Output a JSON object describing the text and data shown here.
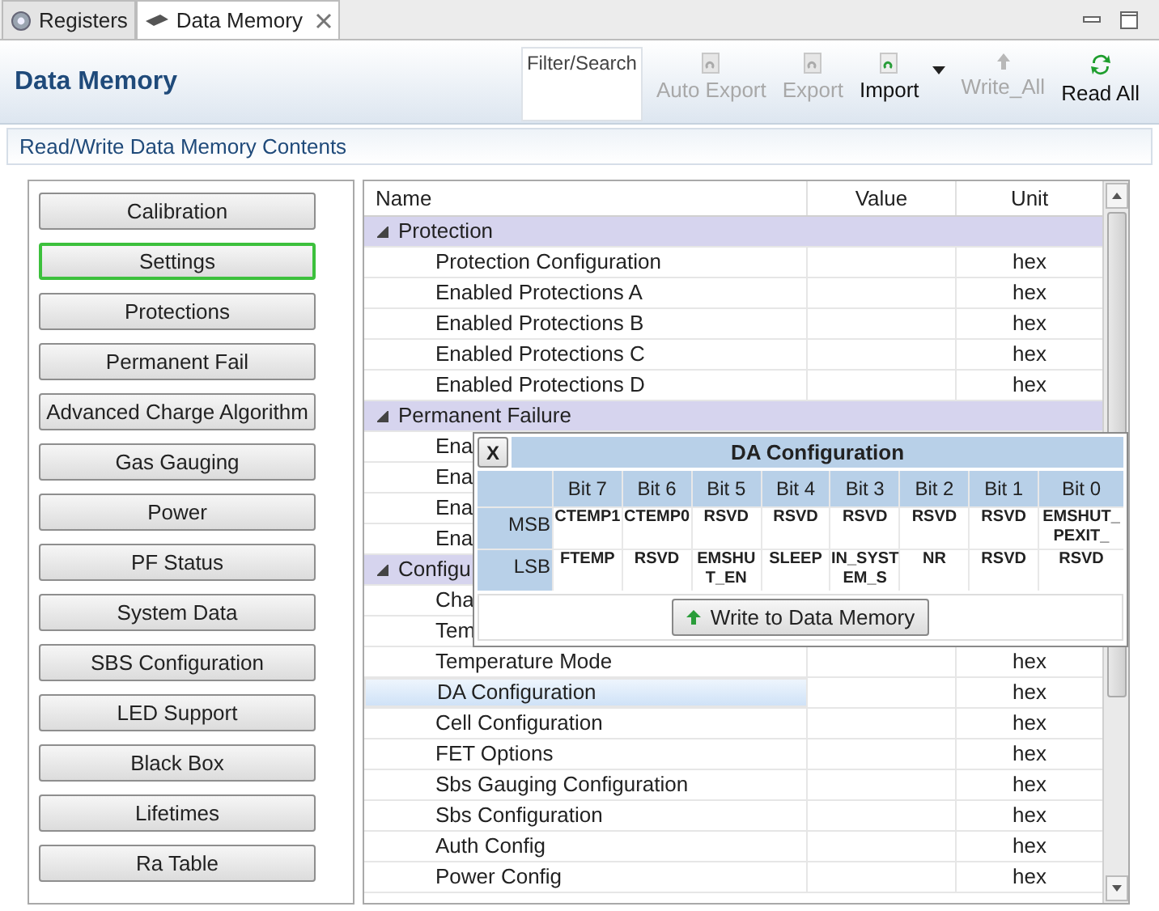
{
  "tabs": [
    {
      "label": "Registers",
      "selected": false,
      "closable": false
    },
    {
      "label": "Data Memory",
      "selected": true,
      "closable": true
    }
  ],
  "header": {
    "title": "Data Memory",
    "filter_placeholder": "Filter/Search"
  },
  "toolbar": [
    {
      "label": "Auto Export",
      "disabled": true,
      "kind": "export"
    },
    {
      "label": "Export",
      "disabled": true,
      "kind": "export"
    },
    {
      "label": "Import",
      "disabled": false,
      "kind": "import",
      "menu": true
    },
    {
      "label": "Write_All",
      "disabled": true,
      "kind": "write"
    },
    {
      "label": "Read All",
      "disabled": false,
      "kind": "read"
    }
  ],
  "section_title": "Read/Write Data Memory Contents",
  "categories": [
    {
      "label": "Calibration",
      "selected": false
    },
    {
      "label": "Settings",
      "selected": true
    },
    {
      "label": "Protections",
      "selected": false
    },
    {
      "label": "Permanent Fail",
      "selected": false
    },
    {
      "label": "Advanced Charge Algorithm",
      "selected": false
    },
    {
      "label": "Gas Gauging",
      "selected": false
    },
    {
      "label": "Power",
      "selected": false
    },
    {
      "label": "PF Status",
      "selected": false
    },
    {
      "label": "System Data",
      "selected": false
    },
    {
      "label": "SBS Configuration",
      "selected": false
    },
    {
      "label": "LED Support",
      "selected": false
    },
    {
      "label": "Black Box",
      "selected": false
    },
    {
      "label": "Lifetimes",
      "selected": false
    },
    {
      "label": "Ra Table",
      "selected": false
    }
  ],
  "table": {
    "columns": [
      "Name",
      "Value",
      "Unit"
    ],
    "groups": [
      {
        "name": "Protection",
        "expanded": true,
        "children": [
          {
            "name": "Protection Configuration",
            "unit": "hex",
            "selected": false
          },
          {
            "name": "Enabled Protections A",
            "unit": "hex",
            "selected": false
          },
          {
            "name": "Enabled Protections B",
            "unit": "hex",
            "selected": false
          },
          {
            "name": "Enabled Protections C",
            "unit": "hex",
            "selected": false
          },
          {
            "name": "Enabled Protections D",
            "unit": "hex",
            "selected": false
          }
        ]
      },
      {
        "name": "Permanent Failure",
        "expanded": true,
        "children": [
          {
            "name": "Ena",
            "selected": false
          },
          {
            "name": "Ena",
            "selected": false
          },
          {
            "name": "Ena",
            "selected": false
          },
          {
            "name": "Ena",
            "selected": false
          }
        ]
      },
      {
        "name": "Configu",
        "expanded": true,
        "children": [
          {
            "name": "Cha",
            "selected": false
          },
          {
            "name": "Tem",
            "selected": false
          },
          {
            "name": "Temperature Mode",
            "unit": "hex",
            "selected": false
          },
          {
            "name": "DA Configuration",
            "unit": "hex",
            "selected": true
          },
          {
            "name": "Cell Configuration",
            "unit": "hex",
            "selected": false
          },
          {
            "name": "FET Options",
            "unit": "hex",
            "selected": false
          },
          {
            "name": "Sbs Gauging Configuration",
            "unit": "hex",
            "selected": false
          },
          {
            "name": "Sbs Configuration",
            "unit": "hex",
            "selected": false
          },
          {
            "name": "Auth Config",
            "unit": "hex",
            "selected": false
          },
          {
            "name": "Power Config",
            "unit": "hex",
            "selected": false
          }
        ]
      }
    ]
  },
  "popup": {
    "close": "X",
    "title": "DA Configuration",
    "bits": [
      "Bit 7",
      "Bit 6",
      "Bit 5",
      "Bit 4",
      "Bit 3",
      "Bit 2",
      "Bit 1",
      "Bit 0"
    ],
    "rows": [
      {
        "label": "MSB",
        "cells": [
          "CTEMP1",
          "CTEMP0",
          "RSVD",
          "RSVD",
          "RSVD",
          "RSVD",
          "RSVD",
          "EMSHUT_PEXIT_"
        ]
      },
      {
        "label": "LSB",
        "cells": [
          "FTEMP",
          "RSVD",
          "EMSHUT_EN",
          "SLEEP",
          "IN_SYSTEM_S",
          "NR",
          "RSVD",
          "RSVD"
        ]
      }
    ],
    "button": "Write to Data Memory"
  }
}
